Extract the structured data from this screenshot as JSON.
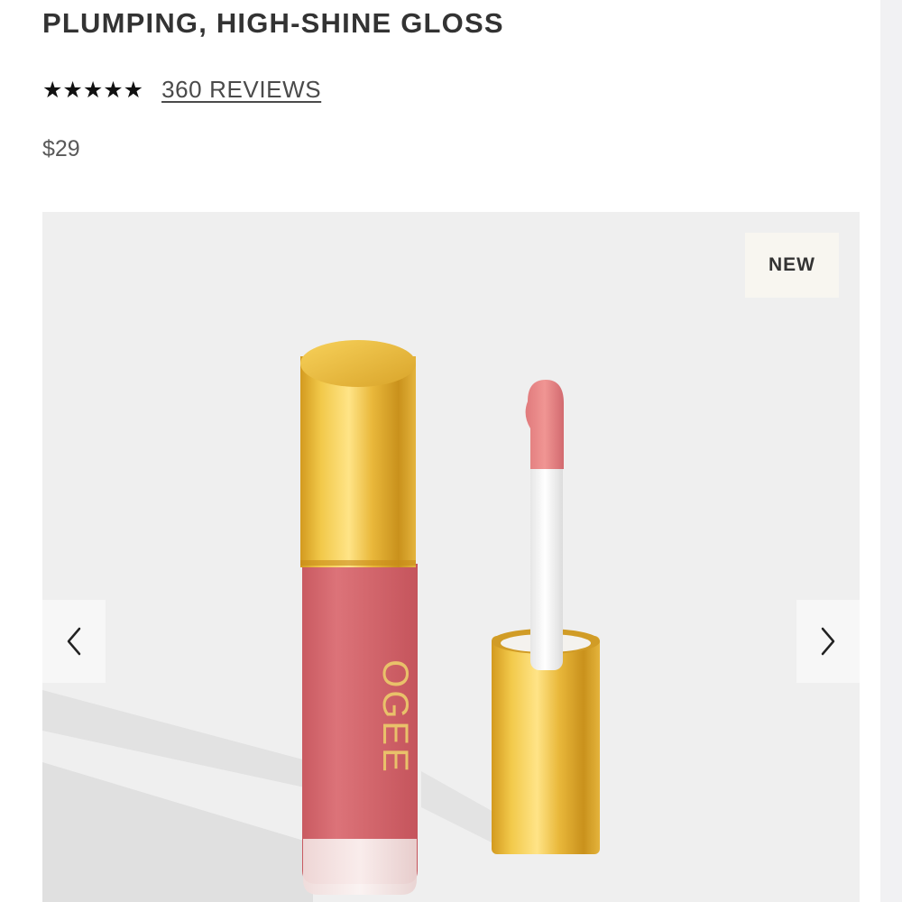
{
  "product": {
    "title": "PLUMPING, HIGH-SHINE GLOSS",
    "rating": 5,
    "rating_stars": "★★★★★",
    "reviews_link": "360 REVIEWS",
    "price": "$29"
  },
  "gallery": {
    "badge": "NEW",
    "brand_mark": "OGEE",
    "prev_icon": "chevron-left-icon",
    "next_icon": "chevron-right-icon"
  },
  "colors": {
    "gloss_pink": "#d2636a",
    "gold": "#e0b239",
    "background": "#efefef"
  }
}
